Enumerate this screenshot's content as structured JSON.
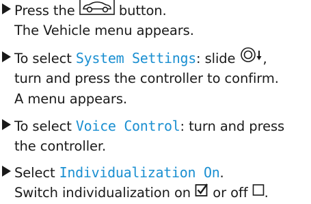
{
  "steps": [
    {
      "lines": [
        {
          "before": "Press the ",
          "icon": "car-icon",
          "after": " button."
        },
        {
          "text": "The Vehicle menu appears."
        }
      ]
    },
    {
      "lines": [
        {
          "before": "To select ",
          "term": "System Settings",
          "mid": ": slide ",
          "icon": "controller-slide-down-icon",
          "after": ","
        },
        {
          "text": "turn and press the controller to confirm."
        },
        {
          "text": "A menu appears."
        }
      ]
    },
    {
      "lines": [
        {
          "before": "To select ",
          "term": "Voice Control",
          "after": ": turn and press"
        },
        {
          "text": "the controller."
        }
      ]
    },
    {
      "lines": [
        {
          "before": "Select ",
          "term": "Individualization On",
          "after": "."
        },
        {
          "before": "Switch individualization on ",
          "icon": "checkbox-checked-icon",
          "mid": " or off ",
          "icon2": "checkbox-empty-icon",
          "after": "."
        }
      ]
    }
  ],
  "colors": {
    "accent": "#1a8fd1",
    "text": "#1a1a1a"
  }
}
